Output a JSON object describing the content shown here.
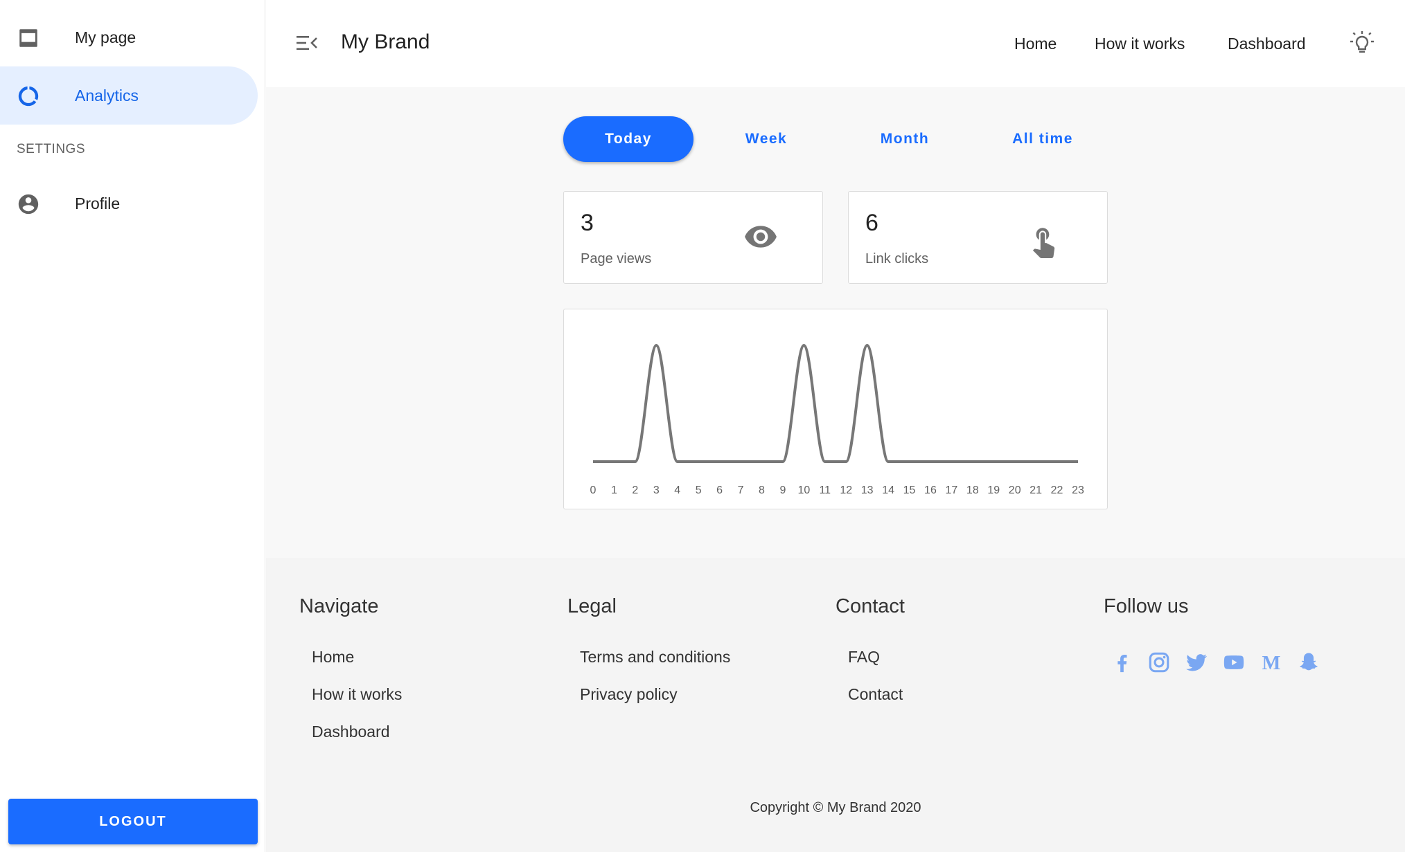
{
  "sidebar": {
    "items": [
      {
        "label": "My page",
        "icon": "page-icon"
      },
      {
        "label": "Analytics",
        "icon": "analytics-icon"
      },
      {
        "label": "Profile",
        "icon": "account-circle-icon"
      }
    ],
    "section": "SETTINGS",
    "logout": "LOGOUT"
  },
  "header": {
    "brand": "My Brand",
    "nav": [
      "Home",
      "How it works",
      "Dashboard"
    ]
  },
  "tabs": [
    "Today",
    "Week",
    "Month",
    "All time"
  ],
  "stats": [
    {
      "value": "3",
      "label": "Page views",
      "icon": "eye-icon"
    },
    {
      "value": "6",
      "label": "Link clicks",
      "icon": "touch-icon"
    }
  ],
  "chart_data": {
    "type": "line",
    "x": [
      0,
      1,
      2,
      3,
      4,
      5,
      6,
      7,
      8,
      9,
      10,
      11,
      12,
      13,
      14,
      15,
      16,
      17,
      18,
      19,
      20,
      21,
      22,
      23
    ],
    "values": [
      0,
      0,
      0,
      1,
      0,
      0,
      0,
      0,
      0,
      0,
      1,
      0,
      0,
      1,
      0,
      0,
      0,
      0,
      0,
      0,
      0,
      0,
      0,
      0
    ],
    "color": "#777777"
  },
  "footer": {
    "columns": [
      {
        "title": "Navigate",
        "links": [
          "Home",
          "How it works",
          "Dashboard"
        ]
      },
      {
        "title": "Legal",
        "links": [
          "Terms and conditions",
          "Privacy policy"
        ]
      },
      {
        "title": "Contact",
        "links": [
          "FAQ",
          "Contact"
        ]
      },
      {
        "title": "Follow us",
        "links": []
      }
    ],
    "social": [
      "facebook-icon",
      "instagram-icon",
      "twitter-icon",
      "youtube-icon",
      "medium-icon",
      "snapchat-icon"
    ],
    "social_color": "#7aa7f2",
    "copyright": "Copyright © My Brand 2020"
  },
  "colors": {
    "accent": "#1a6cff",
    "active_bg": "#e5efff"
  }
}
